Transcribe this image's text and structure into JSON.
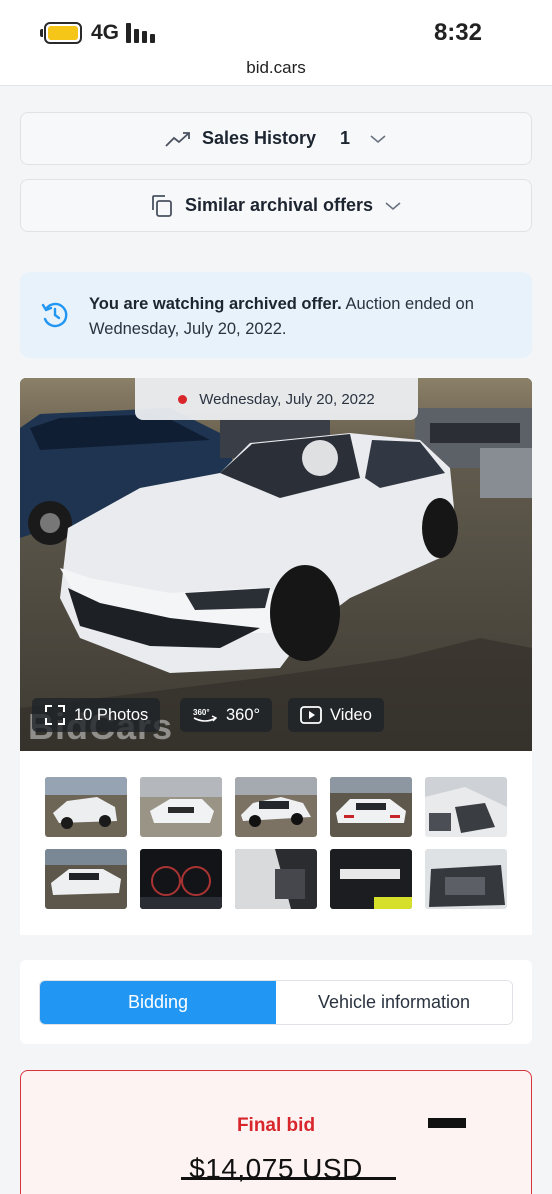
{
  "status_bar": {
    "network": "4G",
    "time": "8:32",
    "battery_level": 0.8
  },
  "url": "bid.cars",
  "sales_history": {
    "label": "Sales History",
    "count": "1"
  },
  "similar_offers": {
    "label": "Similar archival offers"
  },
  "notice": {
    "bold": "You are watching archived offer.",
    "rest": " Auction ended on Wednesday, July 20, 2022."
  },
  "gallery": {
    "date": "Wednesday, July 20, 2022",
    "photos_label": "10 Photos",
    "view360_label": "360°",
    "video_label": "Video",
    "watermark": "BidCars"
  },
  "tabs": [
    {
      "label": "Bidding",
      "active": true
    },
    {
      "label": "Vehicle information",
      "active": false
    }
  ],
  "bid": {
    "label": "Final bid",
    "value": "$14,075 USD"
  },
  "colors": {
    "accent": "#2196f3",
    "danger": "#d7262c",
    "notice_bg": "#e8f2fb"
  }
}
